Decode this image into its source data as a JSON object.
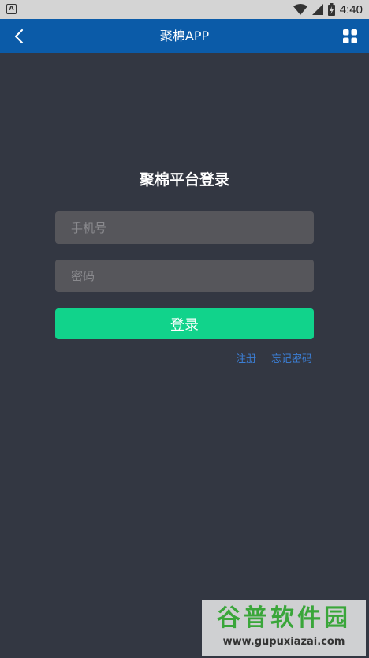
{
  "status_bar": {
    "time": "4:40"
  },
  "app_bar": {
    "title": "聚棉APP"
  },
  "login": {
    "title": "聚棉平台登录",
    "phone_placeholder": "手机号",
    "password_placeholder": "密码",
    "submit_label": "登录",
    "register_label": "注册",
    "forgot_label": "忘记密码"
  },
  "watermark": {
    "logo_text": "谷普软件园",
    "url": "www.gupuxiazai.com"
  },
  "colors": {
    "app_bar": "#0b5ba8",
    "background": "#333742",
    "input_bg": "#56565b",
    "primary_button": "#11d38b",
    "link": "#3c7fd6"
  },
  "icons": [
    "app-notification-icon",
    "wifi-icon",
    "cellular-signal-icon",
    "battery-charging-icon",
    "back-arrow-icon",
    "grid-menu-icon"
  ]
}
